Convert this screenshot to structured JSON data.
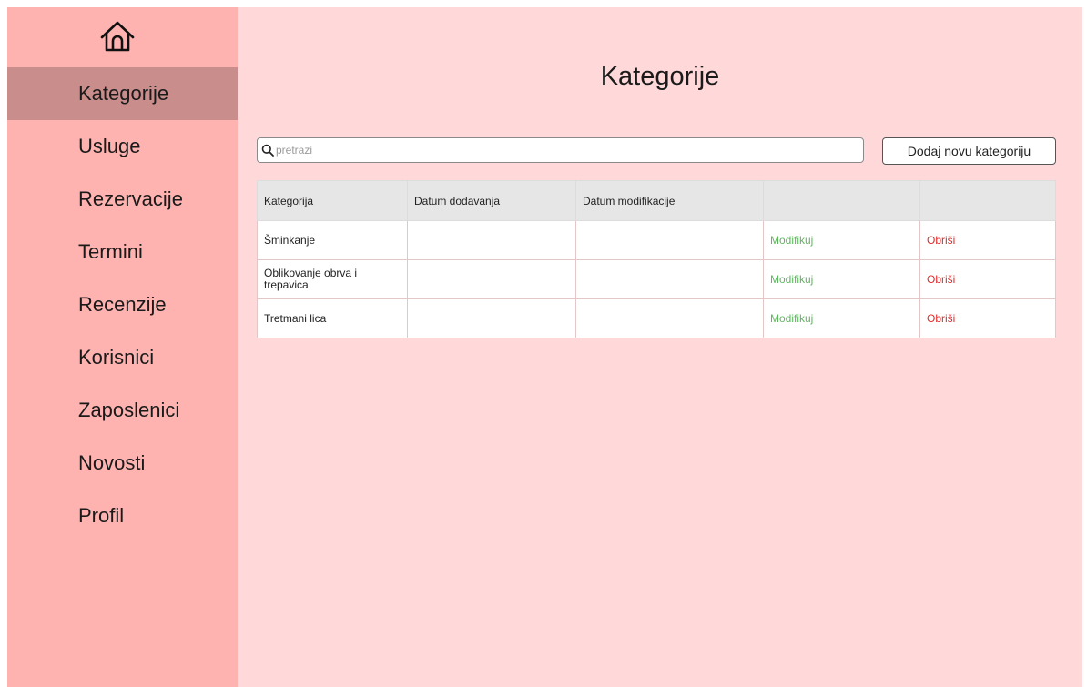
{
  "sidebar": {
    "home_icon": "home-icon",
    "items": [
      {
        "label": "Kategorije",
        "active": true
      },
      {
        "label": "Usluge"
      },
      {
        "label": "Rezervacije"
      },
      {
        "label": "Termini"
      },
      {
        "label": "Recenzije"
      },
      {
        "label": "Korisnici"
      },
      {
        "label": "Zaposlenici"
      },
      {
        "label": "Novosti"
      },
      {
        "label": "Profil"
      }
    ]
  },
  "main": {
    "title": "Kategorije",
    "search": {
      "placeholder": "pretrazi",
      "value": "",
      "icon": "search-icon"
    },
    "add_button_label": "Dodaj novu kategoriju",
    "table": {
      "headers": [
        "Kategorija",
        "Datum dodavanja",
        "Datum modifikacije",
        "",
        ""
      ],
      "rows": [
        {
          "name": "Šminkanje",
          "date_added": "",
          "date_modified": "",
          "edit": "Modifikuj",
          "delete": "Obriši"
        },
        {
          "name": "Oblikovanje obrva i trepavica",
          "date_added": "",
          "date_modified": "",
          "edit": "Modifikuj",
          "delete": "Obriši"
        },
        {
          "name": "Tretmani lica",
          "date_added": "",
          "date_modified": "",
          "edit": "Modifikuj",
          "delete": "Obriši"
        }
      ]
    }
  },
  "colors": {
    "sidebar_bg": "#ffb3b0",
    "sidebar_active": "#c98e8c",
    "main_bg": "#ffd9d9",
    "edit_link": "#5cb85c",
    "delete_link": "#e02a2a"
  }
}
